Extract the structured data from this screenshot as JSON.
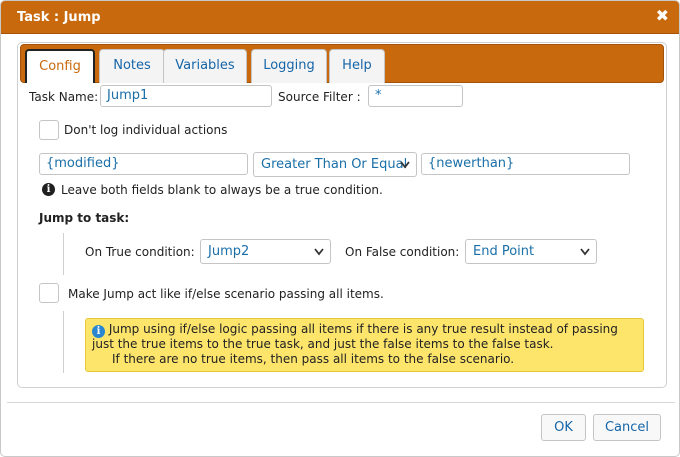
{
  "dialog": {
    "title": "Task : Jump",
    "close_glyph": "✖"
  },
  "tabs": [
    {
      "label": "Config",
      "active": true
    },
    {
      "label": "Notes"
    },
    {
      "label": "Variables"
    },
    {
      "label": "Logging"
    },
    {
      "label": "Help"
    }
  ],
  "config": {
    "task_name_label": "Task Name:",
    "task_name_value": "Jump1",
    "source_filter_label": "Source Filter :",
    "source_filter_value": "*",
    "dont_log_label": "Don't log individual actions",
    "dont_log_checked": false,
    "condition": {
      "left": "{modified}",
      "operator": "Greater Than Or Equal",
      "right": "{newerthan}",
      "hint": "Leave both fields blank to always be a true condition."
    },
    "jump_to_task_label": "Jump to task:",
    "on_true_label": "On True condition:",
    "on_true_value": "Jump2",
    "on_false_label": "On False condition:",
    "on_false_value": "End Point",
    "ifelse_label": "Make Jump act like if/else scenario passing all items.",
    "ifelse_checked": false,
    "ifelse_note": {
      "line1": "Jump using if/else logic passing all items if there is any true result instead of passing",
      "line2": "just the true items to the true task, and just the false items to the false task.",
      "line3": "If there are no true items, then pass all items to the false scenario."
    }
  },
  "footer": {
    "ok_label": "OK",
    "cancel_label": "Cancel"
  },
  "colors": {
    "accent": "#c8690d",
    "link_blue": "#1565a8",
    "note_yellow": "#fde56c"
  },
  "icons": {
    "close": "close-icon",
    "info_dark": "info-icon",
    "info_blue": "info-icon",
    "dropdown": "chevron-down-icon"
  }
}
